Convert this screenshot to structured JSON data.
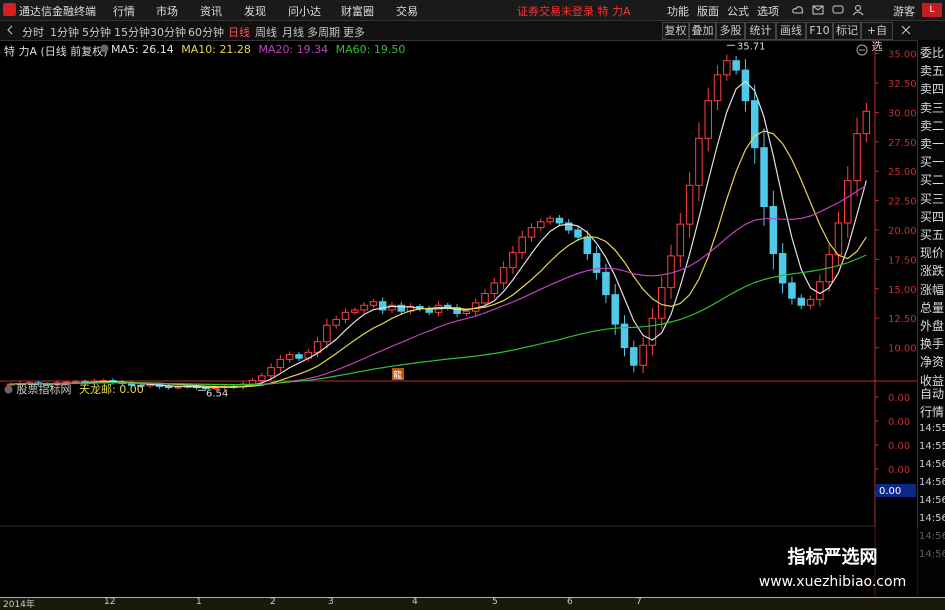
{
  "window": {
    "app_name": "通达信金融终端",
    "status_warning": "证券交易未登录 特 力A"
  },
  "menu": [
    "行情",
    "市场",
    "资讯",
    "发现",
    "问小达",
    "财富圈",
    "交易"
  ],
  "toolbar_right": [
    "功能",
    "版面",
    "公式",
    "选项",
    "游客"
  ],
  "periods": [
    {
      "label": "分时",
      "active": false
    },
    {
      "label": "1分钟",
      "active": false
    },
    {
      "label": "5分钟",
      "active": false
    },
    {
      "label": "15分钟",
      "active": false
    },
    {
      "label": "30分钟",
      "active": false
    },
    {
      "label": "60分钟",
      "active": false
    },
    {
      "label": "日线",
      "active": true
    },
    {
      "label": "周线",
      "active": false
    },
    {
      "label": "月线",
      "active": false
    },
    {
      "label": "多周期",
      "active": false
    },
    {
      "label": "更多",
      "active": false
    }
  ],
  "right_buttons": [
    "复权",
    "叠加",
    "多股",
    "统计",
    "画线",
    "F10",
    "标记",
    "+自选"
  ],
  "chart_header": {
    "stock": "特 力A (日线 前复权)",
    "ma": [
      {
        "name": "MA5",
        "value": "26.14",
        "color": "#e0e0e0"
      },
      {
        "name": "MA10",
        "value": "21.28",
        "color": "#e6d84a"
      },
      {
        "name": "MA20",
        "value": "19.34",
        "color": "#c040c0"
      },
      {
        "name": "MA60",
        "value": "19.50",
        "color": "#30c030"
      }
    ]
  },
  "sub_header": {
    "name": "股票指标网",
    "indicator": "天龙邮:",
    "value": "0.00"
  },
  "side_labels": [
    "委比",
    "卖五",
    "卖四",
    "卖三",
    "卖二",
    "卖一",
    "买一",
    "买二",
    "买三",
    "买四",
    "买五",
    "现价",
    "涨跌",
    "涨幅",
    "总量",
    "外盘",
    "换手",
    "净资",
    "收益"
  ],
  "side_lower": [
    "自动",
    "行情"
  ],
  "side_times": [
    "14:55",
    "14:55",
    "14:56",
    "14:56",
    "14:56",
    "14:56",
    "14:56",
    "14:56"
  ],
  "sub_highlight": "0.00",
  "watermark": {
    "title": "指标严选网",
    "url": "www.xuezhibiao.com"
  },
  "chart_data": {
    "type": "candlestick",
    "y_ticks": [
      "35.00",
      "32.50",
      "30.00",
      "27.50",
      "25.00",
      "22.50",
      "20.00",
      "17.50",
      "15.00",
      "12.50",
      "10.00"
    ],
    "ylim": [
      7.5,
      36.5
    ],
    "sub_y_ticks": [
      "0.00",
      "0.00",
      "0.00",
      "0.00",
      "0.00"
    ],
    "x_ticks": [
      "2014年",
      "12",
      "1",
      "2",
      "3",
      "4",
      "5",
      "6",
      "7"
    ],
    "annotations": {
      "high": "35.71",
      "low": "6.54",
      "marker": "龍"
    },
    "closes": [
      6.9,
      6.95,
      7.0,
      6.9,
      6.85,
      7.0,
      7.05,
      7.1,
      7.0,
      7.15,
      7.2,
      7.05,
      6.95,
      6.8,
      6.75,
      6.85,
      6.7,
      6.6,
      6.65,
      6.7,
      6.6,
      6.55,
      6.6,
      6.7,
      6.65,
      6.9,
      7.2,
      7.6,
      8.3,
      9.0,
      9.4,
      9.1,
      9.6,
      10.5,
      11.9,
      12.4,
      13.0,
      13.2,
      13.6,
      13.9,
      13.2,
      13.6,
      13.1,
      13.5,
      13.3,
      13.0,
      13.6,
      13.4,
      12.9,
      13.1,
      13.8,
      14.6,
      15.5,
      16.8,
      18.1,
      19.4,
      20.2,
      20.7,
      21.0,
      20.6,
      20.0,
      19.4,
      18.0,
      16.4,
      14.5,
      12.0,
      10.0,
      8.5,
      10.2,
      12.5,
      15.1,
      17.8,
      20.5,
      23.8,
      27.8,
      31.0,
      33.2,
      34.4,
      33.6,
      31.0,
      27.0,
      22.0,
      18.0,
      15.5,
      14.2,
      13.6,
      14.1,
      15.6,
      17.9,
      20.6,
      24.2,
      28.2,
      30.1
    ]
  }
}
